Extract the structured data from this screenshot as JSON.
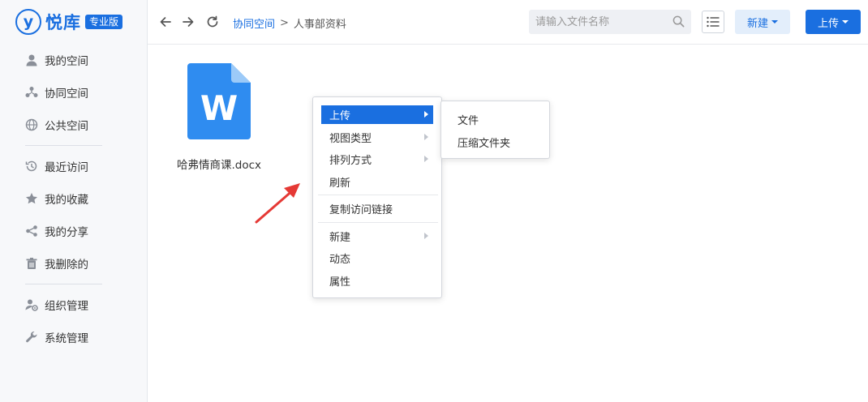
{
  "brand": {
    "mark": "y",
    "name": "悦库",
    "badge": "专业版"
  },
  "sidebar": {
    "items": [
      {
        "label": "我的空间",
        "icon": "user-icon"
      },
      {
        "label": "协同空间",
        "icon": "collaborate-icon"
      },
      {
        "label": "公共空间",
        "icon": "globe-icon"
      },
      {
        "label": "最近访问",
        "icon": "history-icon"
      },
      {
        "label": "我的收藏",
        "icon": "star-icon"
      },
      {
        "label": "我的分享",
        "icon": "share-icon"
      },
      {
        "label": "我删除的",
        "icon": "trash-icon"
      },
      {
        "label": "组织管理",
        "icon": "org-icon"
      },
      {
        "label": "系统管理",
        "icon": "wrench-icon"
      }
    ]
  },
  "header": {
    "breadcrumb": {
      "root": "协同空间",
      "separator": ">",
      "current": "人事部资料"
    },
    "search_placeholder": "请输入文件名称",
    "new_label": "新建",
    "upload_label": "上传"
  },
  "files": [
    {
      "name": "哈弗情商课.docx",
      "icon_letter": "W"
    }
  ],
  "context_menu": {
    "items": [
      {
        "label": "上传",
        "submenu": true,
        "active": true
      },
      {
        "label": "视图类型",
        "submenu": true
      },
      {
        "label": "排列方式",
        "submenu": true
      },
      {
        "label": "刷新"
      },
      {
        "label": "复制访问链接"
      },
      {
        "label": "新建",
        "submenu": true
      },
      {
        "label": "动态"
      },
      {
        "label": "属性"
      }
    ],
    "submenu": [
      {
        "label": "文件"
      },
      {
        "label": "压缩文件夹"
      }
    ]
  },
  "colors": {
    "accent": "#1a6fe0",
    "word_blue": "#2f8cf0",
    "arrow_red": "#e53935"
  }
}
